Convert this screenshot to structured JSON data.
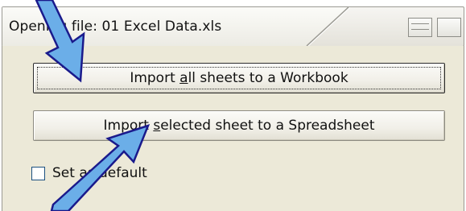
{
  "window": {
    "title": "Opening file:  01 Excel Data.xls"
  },
  "buttons": {
    "import_all_prefix": "Import ",
    "import_all_accel": "a",
    "import_all_suffix": "ll sheets to a Workbook",
    "import_selected_prefix": "Import ",
    "import_selected_accel": "s",
    "import_selected_suffix": "elected sheet to a Spreadsheet"
  },
  "checkbox": {
    "label": "Set as default",
    "checked": false
  },
  "icons": {
    "view_list": "list-view-icon",
    "view_single": "single-view-icon",
    "annotation": "pointer-arrow-icon"
  },
  "colors": {
    "arrow_fill": "#6baee8",
    "arrow_stroke": "#1a1a8c",
    "panel": "#ece9d8"
  }
}
